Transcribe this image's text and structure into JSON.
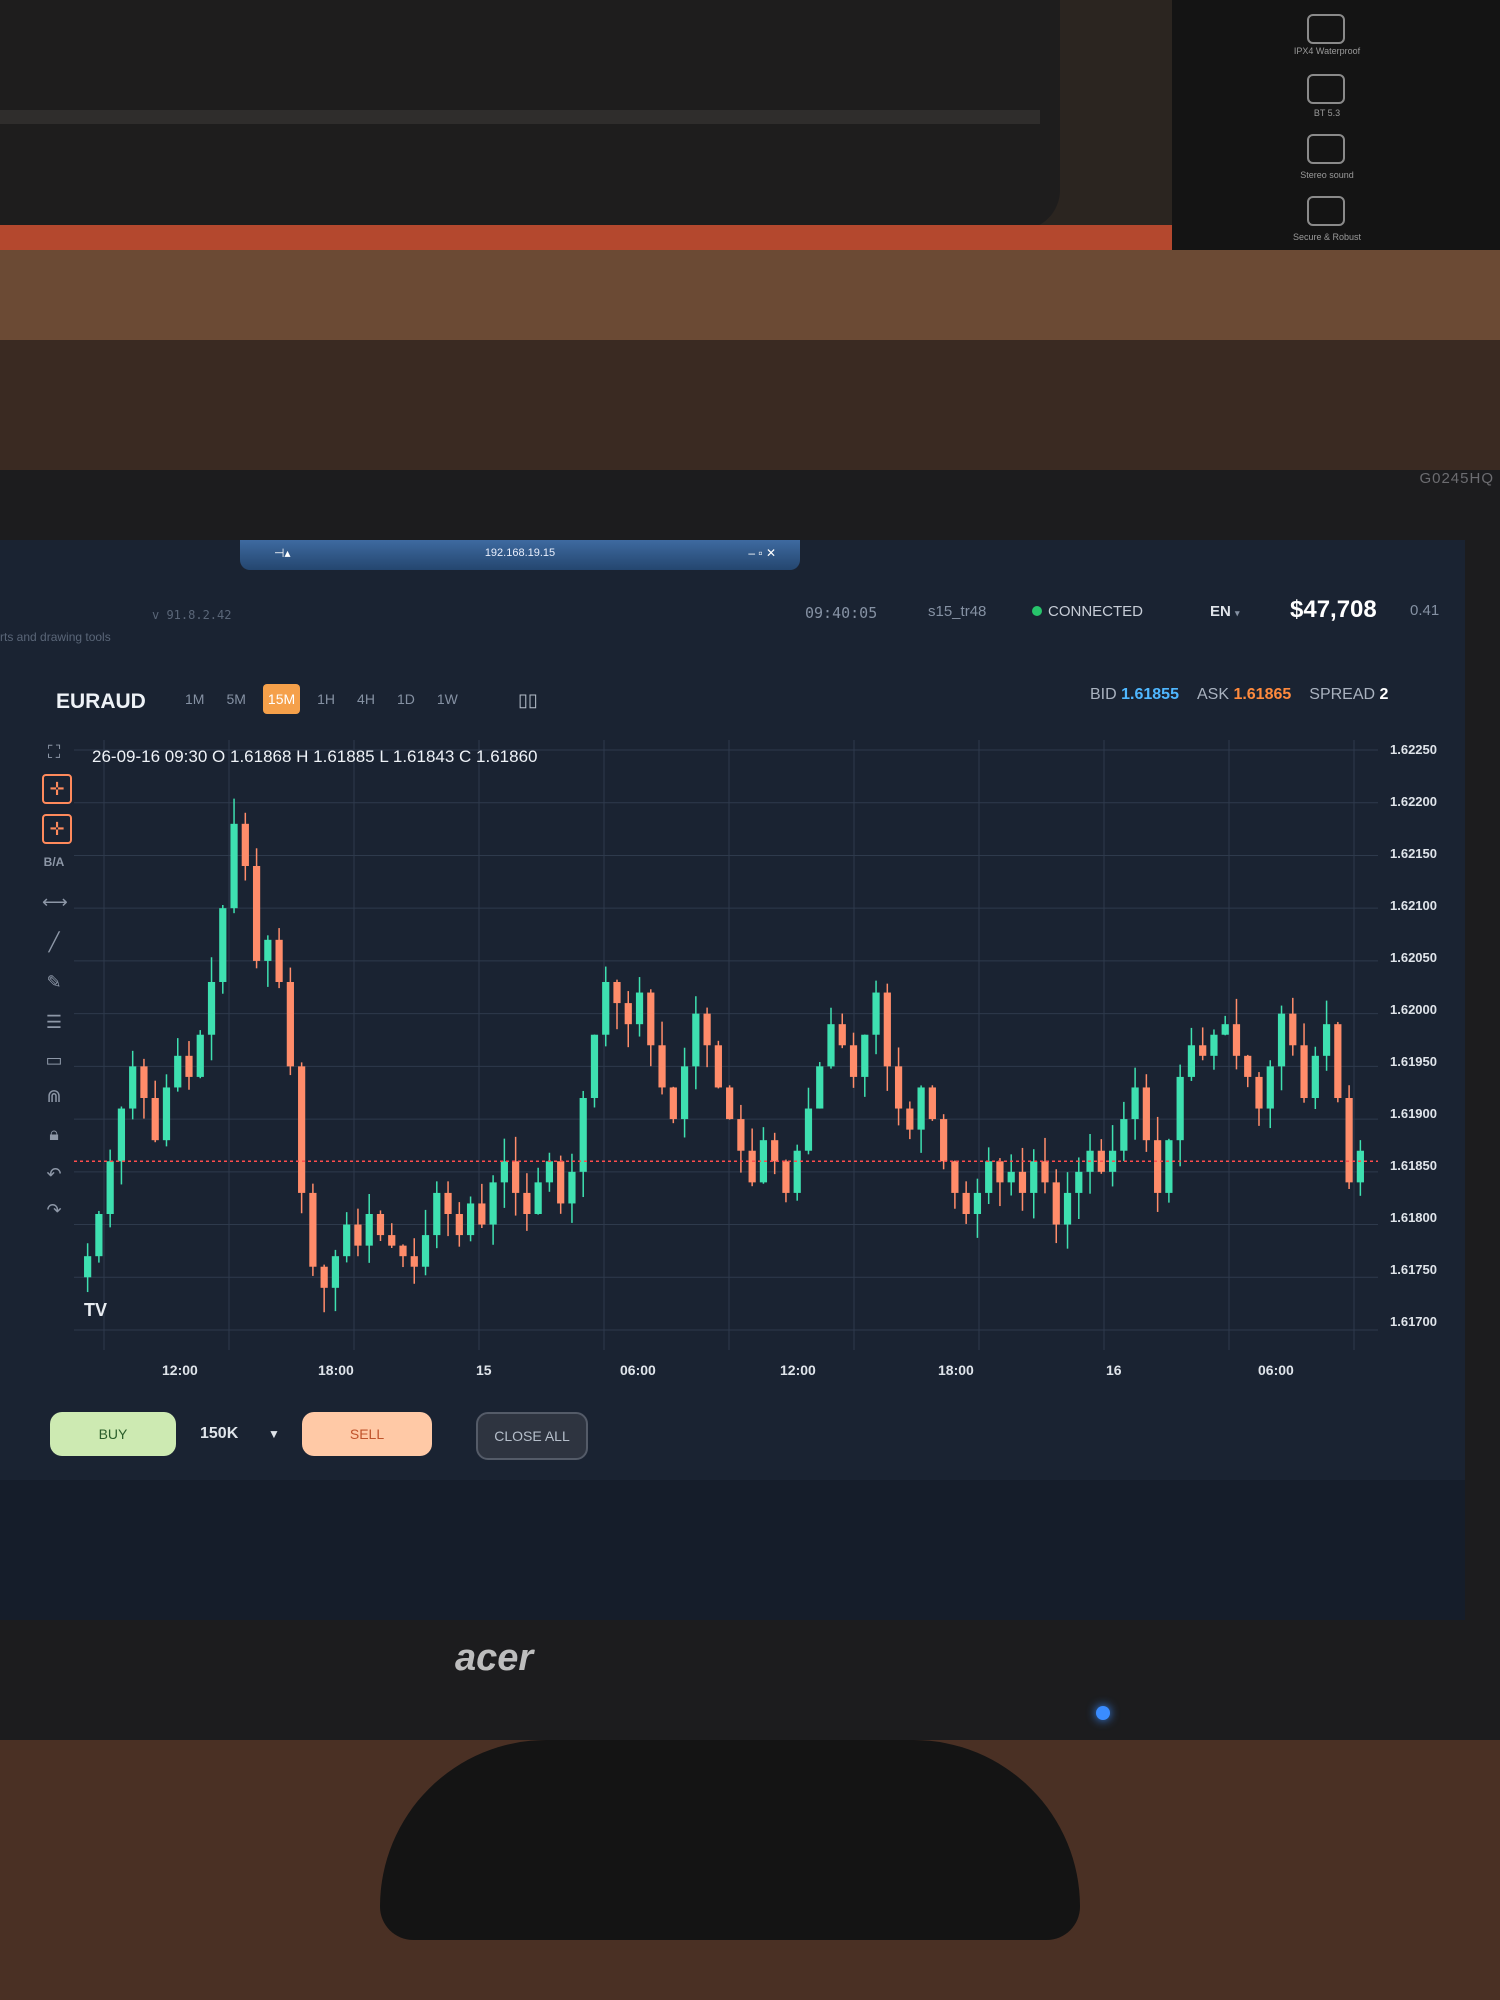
{
  "background_box": {
    "captions": [
      "IPX4 Waterproof",
      "BT 5.3",
      "Stereo sound",
      "Secure & Robust"
    ]
  },
  "monitor": {
    "model": "G0245HQ",
    "brand": "acer"
  },
  "remote_session": {
    "address": "192.168.19.15",
    "controls": "– ▫ ✕"
  },
  "header": {
    "tools_hint": "rts and drawing tools",
    "version": "v 91.8.2.42",
    "clock": "09:40:05",
    "user": "s15_tr48",
    "status": "CONNECTED",
    "language": "EN",
    "balance": "$47,708",
    "pnl": "0.41"
  },
  "instrument": {
    "symbol": "EURAUD",
    "timeframes": [
      "1M",
      "5M",
      "15M",
      "1H",
      "4H",
      "1D",
      "1W"
    ],
    "active_timeframe": "15M",
    "bid_label": "BID",
    "bid": "1.61855",
    "ask_label": "ASK",
    "ask": "1.61865",
    "spread_label": "SPREAD",
    "spread": "2"
  },
  "toolbar": {
    "ba_label": "B/A",
    "icons": [
      "fullscreen-icon",
      "crosshair-icon",
      "add-crosshair-icon",
      "measure-icon",
      "trendline-icon",
      "pencil-icon",
      "fib-lines-icon",
      "rectangle-icon",
      "magnet-icon",
      "lock-icon",
      "undo-icon",
      "redo-icon",
      "trash-icon"
    ]
  },
  "ohlc": "26-09-16 09:30 O 1.61868 H 1.61885 L 1.61843 C 1.61860",
  "trade": {
    "buy": "BUY",
    "quantity": "150K",
    "sell": "SELL",
    "close_all": "CLOSE ALL"
  },
  "colors": {
    "up": "#3ee0b0",
    "down": "#ff8c6a",
    "price_line": "#ff4d4d",
    "background": "#1a2332",
    "grid": "#2e3a4c"
  },
  "chart_data": {
    "type": "candlestick",
    "title": "",
    "x_ticks": [
      "12:00",
      "18:00",
      "15",
      "06:00",
      "12:00",
      "18:00",
      "16",
      "06:00"
    ],
    "y_ticks": [
      "1.62250",
      "1.62200",
      "1.62150",
      "1.62100",
      "1.62050",
      "1.62000",
      "1.61950",
      "1.61900",
      "1.61850",
      "1.61800",
      "1.61750",
      "1.61700"
    ],
    "ylim": [
      1.617,
      1.6225
    ],
    "current_price": 1.6186,
    "grid": true,
    "close_path": [
      1.6177,
      1.6181,
      1.6186,
      1.6191,
      1.6195,
      1.6192,
      1.6188,
      1.6193,
      1.6196,
      1.6194,
      1.6198,
      1.6203,
      1.621,
      1.6218,
      1.6214,
      1.6205,
      1.6207,
      1.6203,
      1.6195,
      1.6183,
      1.6176,
      1.6174,
      1.6177,
      1.618,
      1.6178,
      1.6181,
      1.6179,
      1.6178,
      1.6177,
      1.6176,
      1.6179,
      1.6183,
      1.6181,
      1.6179,
      1.6182,
      1.618,
      1.6184,
      1.6186,
      1.6183,
      1.6181,
      1.6184,
      1.6186,
      1.6182,
      1.6185,
      1.6192,
      1.6198,
      1.6203,
      1.6201,
      1.6199,
      1.6202,
      1.6197,
      1.6193,
      1.619,
      1.6195,
      1.62,
      1.6197,
      1.6193,
      1.619,
      1.6187,
      1.6184,
      1.6188,
      1.6186,
      1.6183,
      1.6187,
      1.6191,
      1.6195,
      1.6199,
      1.6197,
      1.6194,
      1.6198,
      1.6202,
      1.6195,
      1.6191,
      1.6189,
      1.6193,
      1.619,
      1.6186,
      1.6183,
      1.6181,
      1.6183,
      1.6186,
      1.6184,
      1.6185,
      1.6183,
      1.6186,
      1.6184,
      1.618,
      1.6183,
      1.6185,
      1.6187,
      1.6185,
      1.6187,
      1.619,
      1.6193,
      1.6188,
      1.6183,
      1.6188,
      1.6194,
      1.6197,
      1.6196,
      1.6198,
      1.6199,
      1.6196,
      1.6194,
      1.6191,
      1.6195,
      1.62,
      1.6197,
      1.6192,
      1.6196,
      1.6199,
      1.6192,
      1.6184,
      1.6187
    ]
  }
}
